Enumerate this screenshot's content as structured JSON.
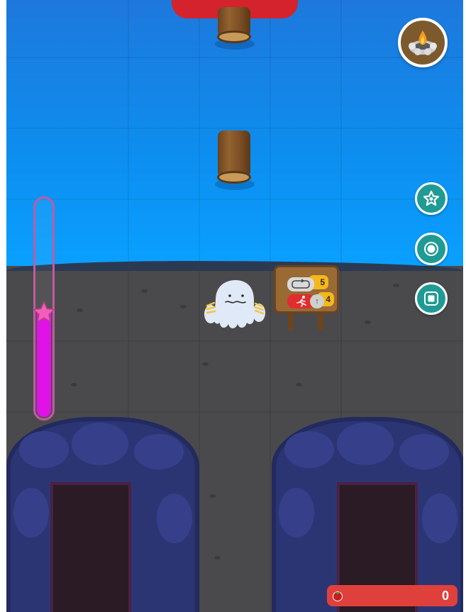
{
  "game": {
    "score": "0",
    "meter_level_fraction": 0.48,
    "signpost": {
      "loop_count": "5",
      "run_count": "4"
    }
  },
  "icons": {
    "campfire": "campfire-icon",
    "star": "star-icon",
    "record": "record-icon",
    "stop": "stop-icon",
    "tomato": "tomato-icon",
    "meter_star": "star-icon"
  },
  "colors": {
    "water": "#0c8ff0",
    "ground": "#4a4a4c",
    "meter_fill": "#e012e6",
    "button_teal": "#1f9b94",
    "score_bar": "#e0403c",
    "top_banner": "#d4232c"
  }
}
